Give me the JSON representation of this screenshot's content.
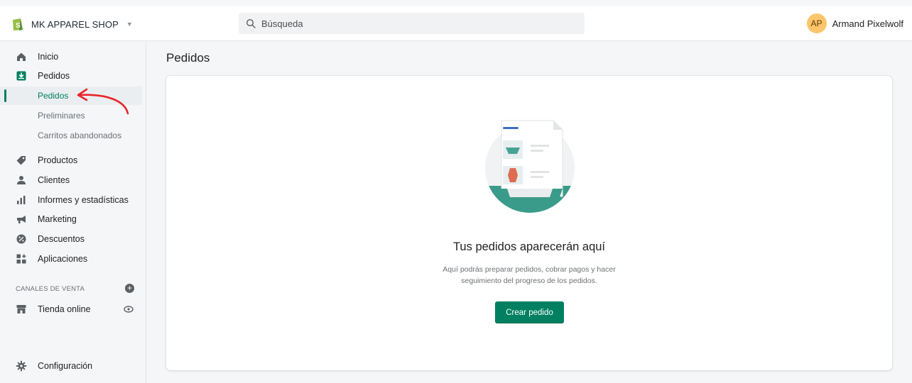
{
  "topbar": {
    "store_name": "MK APPAREL SHOP",
    "search_placeholder": "Búsqueda",
    "user_initials": "AP",
    "user_name": "Armand Pixelwolf"
  },
  "sidebar": {
    "items": [
      {
        "label": "Inicio",
        "icon": "home-icon"
      },
      {
        "label": "Pedidos",
        "icon": "orders-icon"
      },
      {
        "label": "Productos",
        "icon": "tag-icon"
      },
      {
        "label": "Clientes",
        "icon": "person-icon"
      },
      {
        "label": "Informes y estadísticas",
        "icon": "bar-chart-icon"
      },
      {
        "label": "Marketing",
        "icon": "megaphone-icon"
      },
      {
        "label": "Descuentos",
        "icon": "discount-icon"
      },
      {
        "label": "Aplicaciones",
        "icon": "apps-icon"
      }
    ],
    "subitems": [
      {
        "label": "Pedidos",
        "active": true
      },
      {
        "label": "Preliminares"
      },
      {
        "label": "Carritos abandonados"
      }
    ],
    "sales_channels_title": "CANALES DE VENTA",
    "online_store": "Tienda online",
    "settings": "Configuración"
  },
  "main": {
    "page_title": "Pedidos",
    "empty_title": "Tus pedidos aparecerán aquí",
    "empty_text": "Aquí podrás preparar pedidos, cobrar pagos y hacer seguimiento del progreso de los pedidos.",
    "create_button": "Crear pedido"
  },
  "colors": {
    "primary": "#008060",
    "avatar": "#fdc56b",
    "annotation_arrow": "#e8252a"
  }
}
